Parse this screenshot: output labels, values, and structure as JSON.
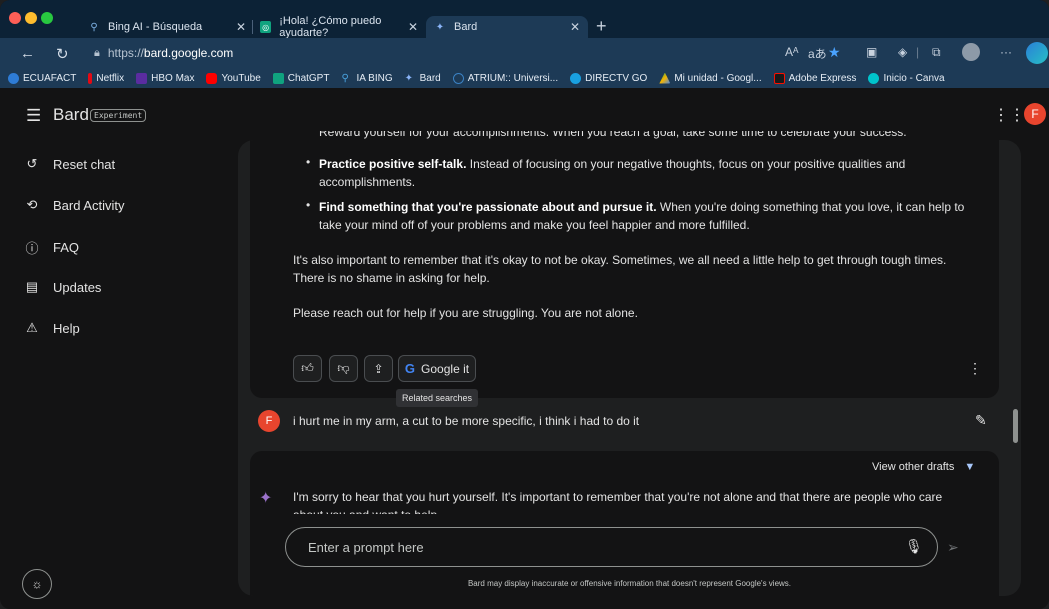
{
  "browser": {
    "tabs": [
      {
        "label": "Bing AI - Búsqueda",
        "icon": "search-icon"
      },
      {
        "label": "¡Hola! ¿Cómo puedo ayudarte?",
        "icon": "chatgpt-icon"
      },
      {
        "label": "Bard",
        "icon": "bard-sparkle-icon"
      }
    ],
    "url_prefix": "https://",
    "url_domain": "bard.google.com",
    "bookmarks": [
      {
        "label": "ECUAFACT",
        "color": "#2e7cd6"
      },
      {
        "label": "Netflix",
        "color": "#e50914"
      },
      {
        "label": "HBO Max",
        "color": "#5a2ca0"
      },
      {
        "label": "YouTube",
        "color": "#ff0000"
      },
      {
        "label": "ChatGPT",
        "color": "#10a37f"
      },
      {
        "label": "IA BING",
        "color": "#4aa3df"
      },
      {
        "label": "Bard",
        "color": "#8ab4f8"
      },
      {
        "label": "ATRIUM:: Universi...",
        "color": "#3b82c4"
      },
      {
        "label": "DIRECTV GO",
        "color": "#19a0e0"
      },
      {
        "label": "Mi unidad - Googl...",
        "color": "#f4b400"
      },
      {
        "label": "Adobe Express",
        "color": "#fa0f00"
      },
      {
        "label": "Inicio - Canva",
        "color": "#00c4cc"
      }
    ]
  },
  "app": {
    "brand": "Bard",
    "badge": "Experiment",
    "avatar_letter": "F"
  },
  "sidebar": {
    "items": [
      {
        "label": "Reset chat",
        "icon": "reset-icon"
      },
      {
        "label": "Bard Activity",
        "icon": "history-icon"
      },
      {
        "label": "FAQ",
        "icon": "help-circle-icon"
      },
      {
        "label": "Updates",
        "icon": "calendar-icon"
      },
      {
        "label": "Help",
        "icon": "feedback-icon"
      }
    ]
  },
  "response": {
    "cut_top_line": "Reward yourself for your accomplishments. When you reach a goal, take some time to celebrate your success.",
    "bullet2_bold": "Practice positive self-talk.",
    "bullet2_rest": " Instead of focusing on your negative thoughts, focus on your positive qualities and",
    "bullet2_line2": "accomplishments.",
    "bullet3_bold": "Find something that you're passionate about and pursue it.",
    "bullet3_rest": " When you're doing something that you love, it can help to",
    "bullet3_line2": "take your mind off of your problems and make you feel happier and more fulfilled.",
    "para1_line1": "It's also important to remember that it's okay to not be okay. Sometimes, we all need a little help to get through tough times.",
    "para1_line2": "There is no shame in asking for help.",
    "para2": "Please reach out for help if you are struggling. You are not alone.",
    "google_it": "Google it",
    "tooltip": "Related searches"
  },
  "user_message": "i hurt me in my arm, a cut to be more specific, i think i had to do it",
  "next_response": {
    "view_drafts": "View other drafts",
    "line1": "I'm sorry to hear that you hurt yourself. It's important to remember that you're not alone and that there are people who care",
    "line2_cut": "about you and want to help."
  },
  "composer": {
    "placeholder": "Enter a prompt here",
    "disclaimer": "Bard may display inaccurate or offensive information that doesn't represent Google's views."
  }
}
